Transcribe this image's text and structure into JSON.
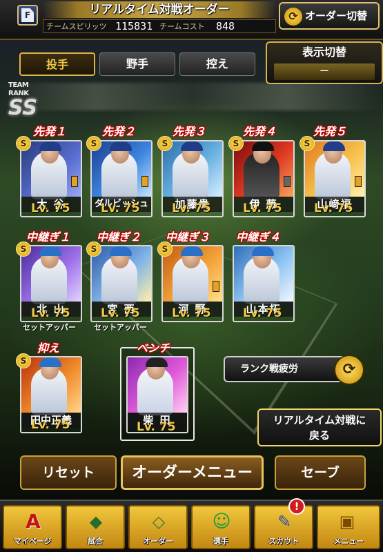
{
  "header": {
    "logo_icon": "f-logo-icon",
    "title": "リアルタイム対戦オーダー",
    "team_spirit_label": "チームスピリッツ",
    "team_spirit_value": "115831",
    "team_cost_label": "チームコスト",
    "team_cost_value": "848",
    "order_switch_label": "オーダー切替",
    "order_switch_icon": "refresh-icon"
  },
  "tabs": [
    {
      "label": "投手",
      "active": true
    },
    {
      "label": "野手",
      "active": false
    },
    {
      "label": "控え",
      "active": false
    }
  ],
  "display_switch": {
    "title": "表示切替",
    "value": "ー"
  },
  "team_rank": {
    "label": "TEAM RANK",
    "value": "SS"
  },
  "starters": [
    {
      "slot": "先発１",
      "name": "大 谷",
      "level": "Lv. 75"
    },
    {
      "slot": "先発２",
      "name": "ダルビッシュ",
      "level": "Lv. 75"
    },
    {
      "slot": "先発３",
      "name": "加藤貴",
      "level": "Lv. 75"
    },
    {
      "slot": "先発４",
      "name": "伊 藤",
      "level": "Lv. 75"
    },
    {
      "slot": "先発５",
      "name": "山﨑福",
      "level": "Lv. 75"
    }
  ],
  "relievers": [
    {
      "slot": "中継ぎ１",
      "name": "北 山",
      "level": "Lv. 75",
      "sub": "セットアッパー"
    },
    {
      "slot": "中継ぎ２",
      "name": "宮 西",
      "level": "Lv. 75",
      "sub": "セットアッパー"
    },
    {
      "slot": "中継ぎ３",
      "name": "河 野",
      "level": "Lv. 75",
      "sub": ""
    },
    {
      "slot": "中継ぎ４",
      "name": "山本拓",
      "level": "Lv. 75",
      "sub": ""
    }
  ],
  "closer": {
    "slot": "抑え",
    "name": "田中正義",
    "level": "Lv. 75"
  },
  "bench": {
    "slot": "ベンチ",
    "name": "柴 田",
    "level": "Lv. 75"
  },
  "rank_fatigue": {
    "label": "ランク戦疲労",
    "icon": "refresh-icon"
  },
  "return_button": {
    "line1": "リアルタイム対戦に",
    "line2": "戻る"
  },
  "bottom_buttons": {
    "reset": "リセット",
    "order_menu": "オーダーメニュー",
    "save": "セーブ"
  },
  "nav": [
    {
      "label": "マイページ",
      "icon": "a-logo-icon"
    },
    {
      "label": "試合",
      "icon": "stadium-icon"
    },
    {
      "label": "オーダー",
      "icon": "field-icon"
    },
    {
      "label": "選手",
      "icon": "player-icon"
    },
    {
      "label": "スカウト",
      "icon": "scout-icon"
    },
    {
      "label": "メニュー",
      "icon": "menu-icon"
    }
  ],
  "alert_badge": "!",
  "colors": {
    "accent_gold": "#f0c84a",
    "slot_red": "#cc0000",
    "nav_gold": "#f1c73c"
  }
}
